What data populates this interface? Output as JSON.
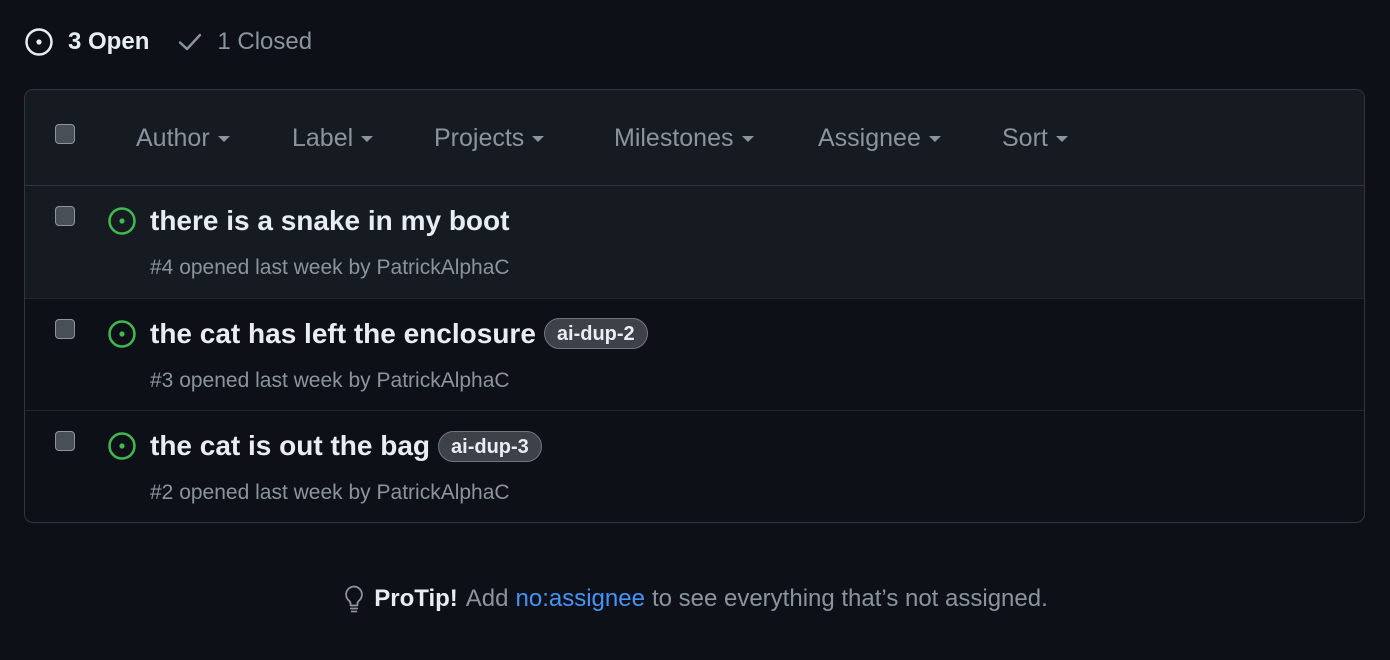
{
  "states": {
    "open_label": "3 Open",
    "closed_label": "1 Closed"
  },
  "filters": {
    "author": "Author",
    "label": "Label",
    "projects": "Projects",
    "milestones": "Milestones",
    "assignee": "Assignee",
    "sort": "Sort"
  },
  "issues": [
    {
      "title": "there is a snake in my boot",
      "label": "",
      "number": "#4",
      "opened": "opened last week by",
      "author": "PatrickAlphaC"
    },
    {
      "title": "the cat has left the enclosure",
      "label": "ai-dup-2",
      "number": "#3",
      "opened": "opened last week by",
      "author": "PatrickAlphaC"
    },
    {
      "title": "the cat is out the bag",
      "label": "ai-dup-3",
      "number": "#2",
      "opened": "opened last week by",
      "author": "PatrickAlphaC"
    }
  ],
  "protip": {
    "bold": "ProTip!",
    "before": "Add",
    "link": "no:assignee",
    "after": "to see everything that’s not assigned."
  },
  "colors": {
    "background": "#0d1117",
    "open_icon": "#3fb950",
    "link": "#4493f8",
    "muted": "#8b949e"
  }
}
